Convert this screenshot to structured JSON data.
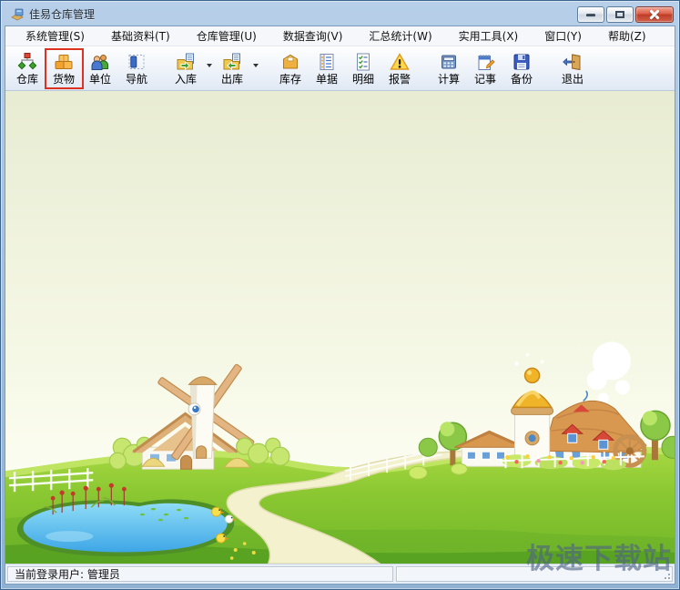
{
  "window": {
    "title": "佳易仓库管理",
    "app_icon": "warehouse-app-icon",
    "controls": {
      "minimize": "minimize-icon",
      "maximize": "maximize-icon",
      "close": "close-icon"
    }
  },
  "menu": {
    "items": [
      "系统管理(S)",
      "基础资料(T)",
      "仓库管理(U)",
      "数据查询(V)",
      "汇总统计(W)",
      "实用工具(X)",
      "窗口(Y)",
      "帮助(Z)"
    ]
  },
  "toolbar": {
    "buttons": [
      {
        "label": "仓库",
        "icon": "warehouse-hierarchy-icon",
        "dropdown": false,
        "highlighted": false
      },
      {
        "label": "货物",
        "icon": "goods-boxes-icon",
        "dropdown": false,
        "highlighted": true
      },
      {
        "label": "单位",
        "icon": "units-people-icon",
        "dropdown": false,
        "highlighted": false
      },
      {
        "label": "导航",
        "icon": "navigation-panel-icon",
        "dropdown": false,
        "highlighted": false
      },
      {
        "label": "入库",
        "icon": "stock-in-icon",
        "dropdown": true,
        "highlighted": false
      },
      {
        "label": "出库",
        "icon": "stock-out-icon",
        "dropdown": true,
        "highlighted": false
      },
      {
        "label": "库存",
        "icon": "inventory-box-icon",
        "dropdown": false,
        "highlighted": false
      },
      {
        "label": "单据",
        "icon": "documents-list-icon",
        "dropdown": false,
        "highlighted": false
      },
      {
        "label": "明细",
        "icon": "detail-checklist-icon",
        "dropdown": false,
        "highlighted": false
      },
      {
        "label": "报警",
        "icon": "alert-warning-icon",
        "dropdown": false,
        "highlighted": false
      },
      {
        "label": "计算",
        "icon": "calculator-icon",
        "dropdown": false,
        "highlighted": false
      },
      {
        "label": "记事",
        "icon": "notes-notepad-icon",
        "dropdown": false,
        "highlighted": false
      },
      {
        "label": "备份",
        "icon": "backup-disk-icon",
        "dropdown": false,
        "highlighted": false
      },
      {
        "label": "退出",
        "icon": "exit-door-icon",
        "dropdown": false,
        "highlighted": false
      }
    ],
    "highlight_annotation": {
      "target": "货物",
      "border_color": "#dd3222"
    }
  },
  "statusbar": {
    "left_text": "当前登录用户: 管理员",
    "right_text": ""
  },
  "watermark": {
    "text": "极速下载站"
  },
  "illustration": {
    "alt": "cartoon-countryside-with-windmill-village-pond-and-winding-path"
  },
  "colors": {
    "titlebar": "#a6c2de",
    "close_button": "#bd3c25",
    "toolbar_highlight_border": "#dd3222",
    "sky_top": "#e8ecd2",
    "grass": "#8bc832",
    "pond": "#4fb4ec",
    "watermark": "#4e6384"
  }
}
